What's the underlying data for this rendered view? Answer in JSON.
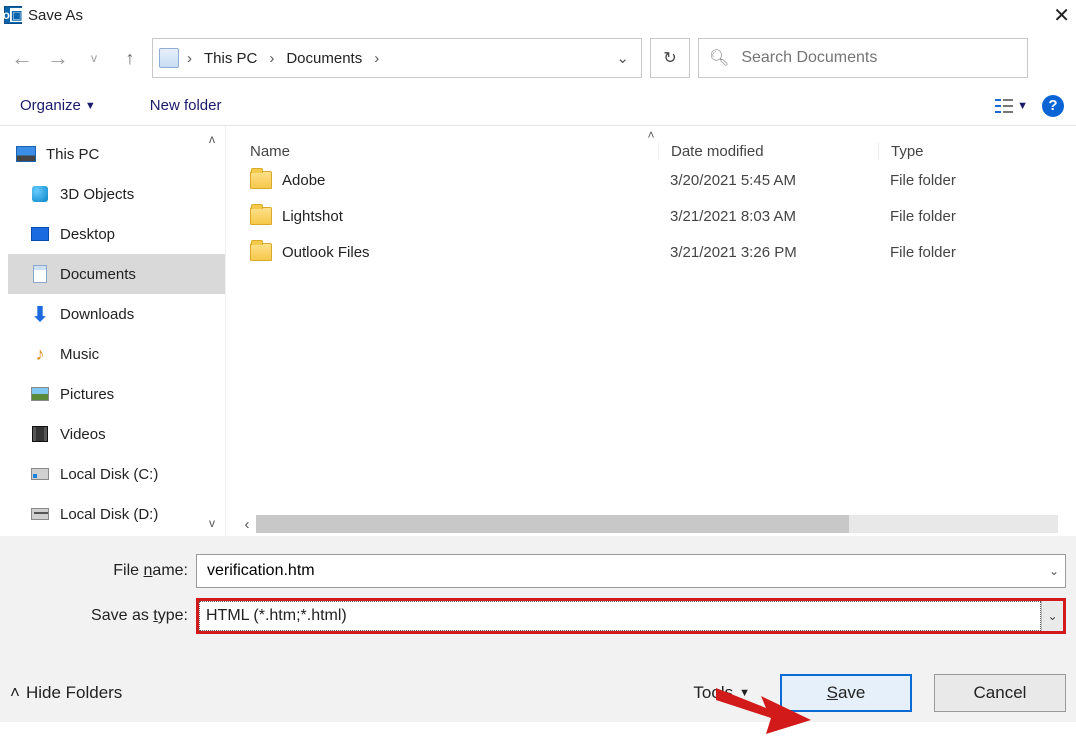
{
  "title": "Save As",
  "breadcrumb": {
    "seg1": "This PC",
    "seg2": "Documents"
  },
  "search": {
    "placeholder": "Search Documents"
  },
  "toolbar": {
    "organize": "Organize",
    "newfolder": "New folder"
  },
  "tree": {
    "thispc": "This PC",
    "items": [
      {
        "label": "3D Objects"
      },
      {
        "label": "Desktop"
      },
      {
        "label": "Documents"
      },
      {
        "label": "Downloads"
      },
      {
        "label": "Music"
      },
      {
        "label": "Pictures"
      },
      {
        "label": "Videos"
      },
      {
        "label": "Local Disk (C:)"
      },
      {
        "label": "Local Disk (D:)"
      }
    ]
  },
  "columns": {
    "name": "Name",
    "date": "Date modified",
    "type": "Type"
  },
  "rows": [
    {
      "name": "Adobe",
      "date": "3/20/2021 5:45 AM",
      "type": "File folder"
    },
    {
      "name": "Lightshot",
      "date": "3/21/2021 8:03 AM",
      "type": "File folder"
    },
    {
      "name": "Outlook Files",
      "date": "3/21/2021 3:26 PM",
      "type": "File folder"
    }
  ],
  "filename": {
    "label": "File name:",
    "value": "verification.htm"
  },
  "filetype": {
    "label": "Save as type:",
    "value": "HTML (*.htm;*.html)"
  },
  "footer": {
    "hide": "Hide Folders",
    "tools": "Tools",
    "save": "Save",
    "cancel": "Cancel"
  }
}
